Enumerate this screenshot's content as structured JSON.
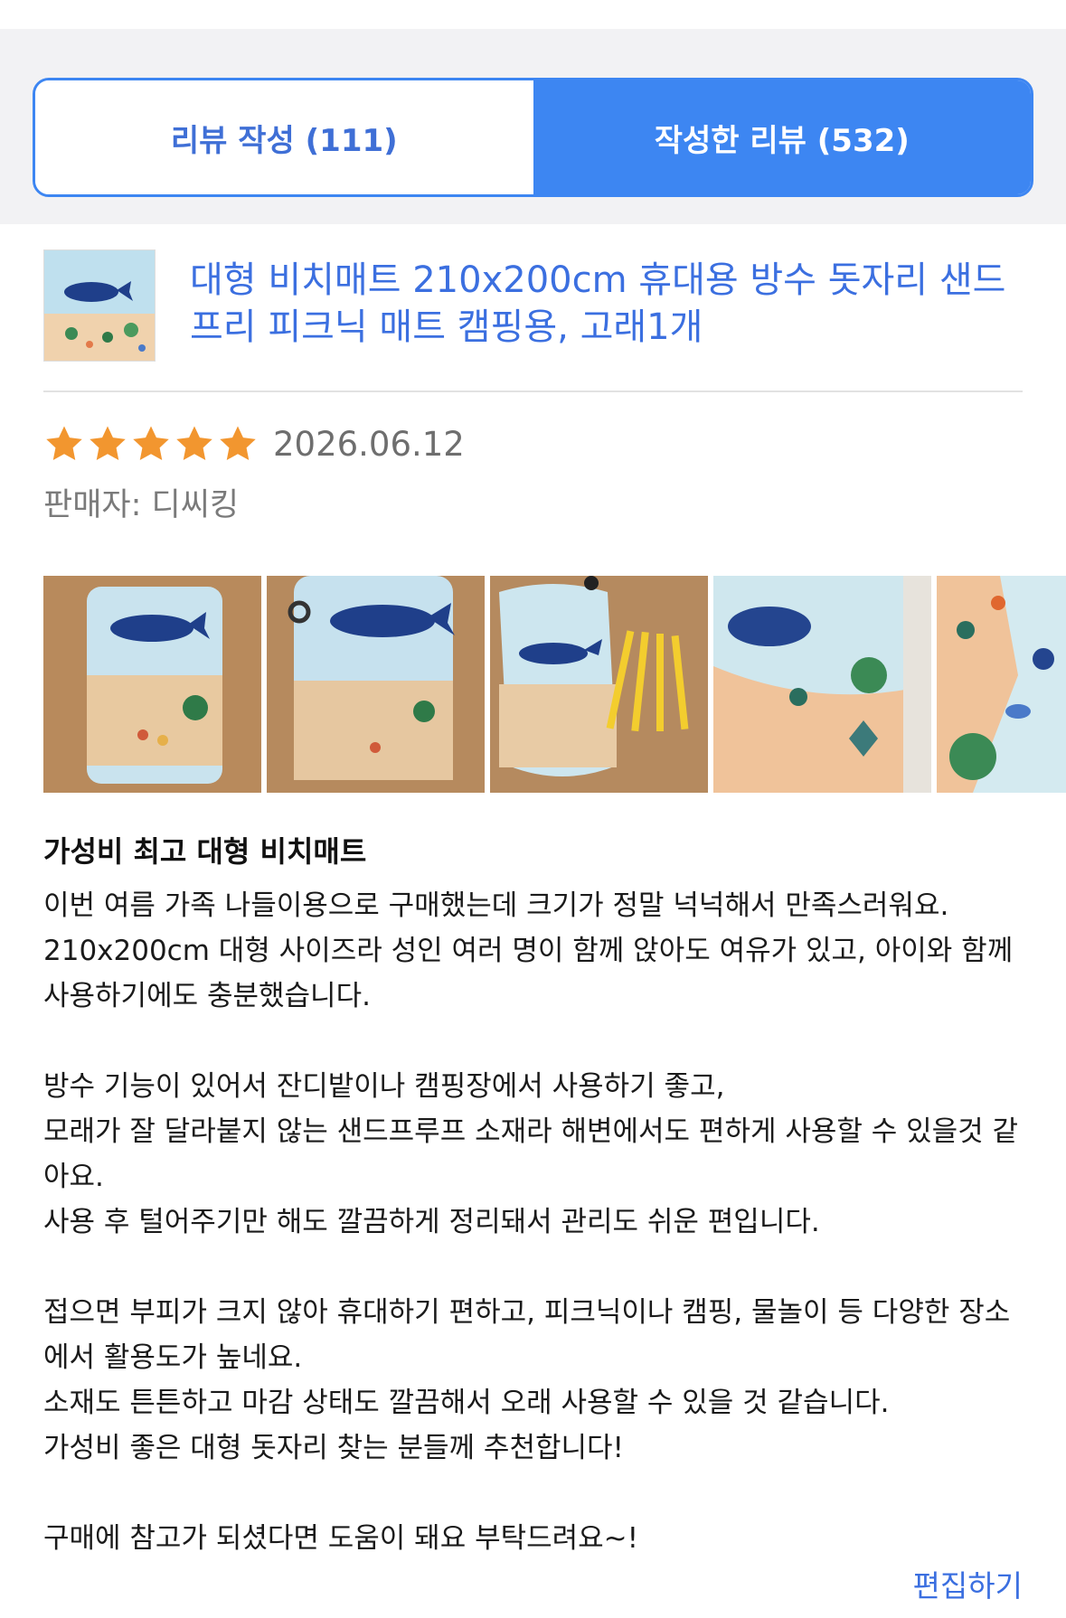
{
  "tabs": [
    {
      "label": "리뷰 작성 (111)",
      "active": false
    },
    {
      "label": "작성한 리뷰 (532)",
      "active": true
    }
  ],
  "product": {
    "title": "대형 비치매트 210x200cm 휴대용 방수 돗자리 샌드프리 피크닉 매트 캠핑용, 고래1개",
    "thumbnail_icon": "whale-beach-mat-thumbnail"
  },
  "review": {
    "rating": 5,
    "rating_max": 5,
    "date": "2026.06.12",
    "seller": "판매자: 디씨킹",
    "photos": [
      {
        "icon": "folded-whale-mat-photo"
      },
      {
        "icon": "packed-whale-mat-photo"
      },
      {
        "icon": "mat-bag-with-pegs-photo"
      },
      {
        "icon": "unfolded-whale-mat-photo"
      },
      {
        "icon": "mat-sea-pattern-photo"
      }
    ],
    "title": "가성비 최고 대형 비치매트",
    "paragraphs": [
      "이번 여름 가족 나들이용으로 구매했는데 크기가 정말 넉넉해서 만족스러워요.\n210x200cm 대형 사이즈라 성인 여러 명이 함께 앉아도 여유가 있고, 아이와 함께 사용하기에도 충분했습니다.",
      "방수 기능이 있어서 잔디밭이나 캠핑장에서 사용하기 좋고,\n모래가 잘 달라붙지 않는 샌드프루프 소재라 해변에서도 편하게 사용할 수 있을것 같아요.\n사용 후 털어주기만 해도 깔끔하게 정리돼서 관리도 쉬운 편입니다.",
      "접으면 부피가 크지 않아 휴대하기 편하고, 피크닉이나 캠핑, 물놀이 등 다양한 장소에서 활용도가 높네요.\n소재도 튼튼하고 마감 상태도 깔끔해서 오래 사용할 수 있을 것 같습니다.\n가성비 좋은 대형 돗자리 찾는 분들께 추천합니다!",
      "구매에 참고가 되셨다면 도움이 돼요 부탁드려요~!"
    ],
    "edit_label": "편집하기"
  },
  "colors": {
    "accent": "#3d86f2",
    "link": "#3b6fe0",
    "star": "#f2962f"
  }
}
